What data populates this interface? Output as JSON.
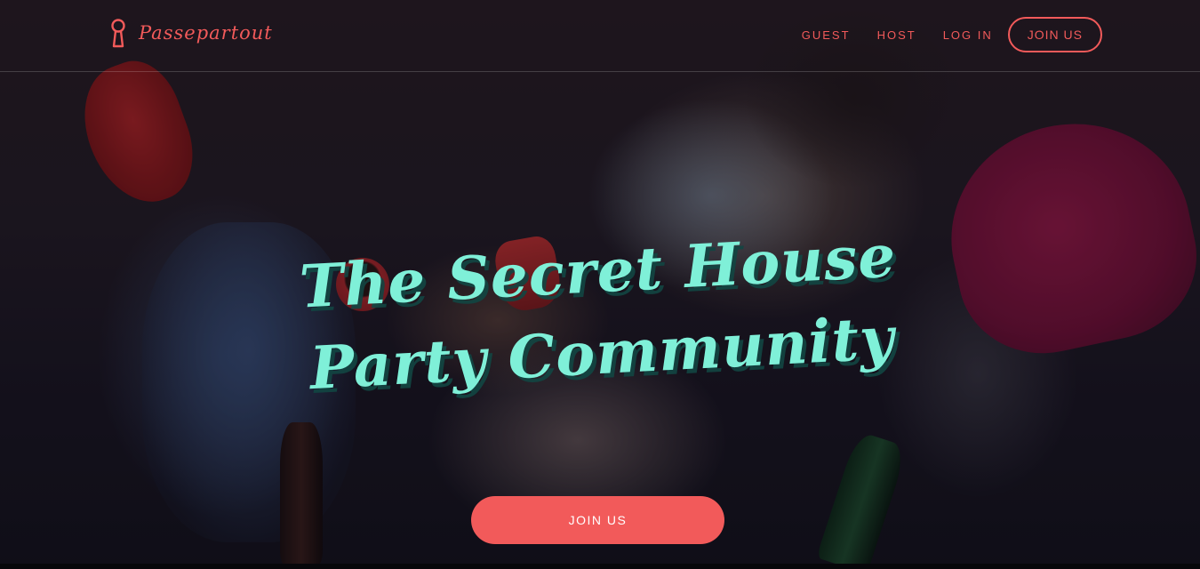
{
  "brand": {
    "name": "Passepartout",
    "icon": "keyhole-icon",
    "color": "#f25a5a"
  },
  "nav": {
    "links": [
      "GUEST",
      "HOST",
      "LOG IN"
    ],
    "join_label": "JOIN US"
  },
  "hero": {
    "headline_line1": "The Secret House",
    "headline_line2": "Party Community",
    "cta_label": "JOIN US",
    "headline_color": "#7ff0d8",
    "accent_color": "#f25a5a"
  }
}
